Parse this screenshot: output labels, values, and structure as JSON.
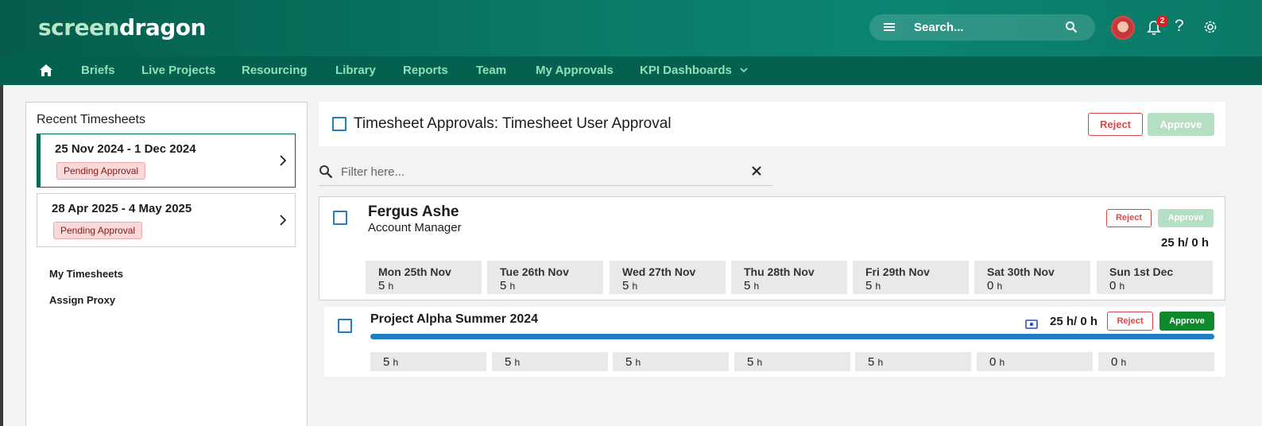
{
  "brand": {
    "logo_part1": "screen",
    "logo_part2": "dragon"
  },
  "header": {
    "search_placeholder": "Search...",
    "notification_count": "2",
    "help_symbol": "?"
  },
  "nav": {
    "items": [
      "Briefs",
      "Live Projects",
      "Resourcing",
      "Library",
      "Reports",
      "Team",
      "My Approvals",
      "KPI Dashboards"
    ]
  },
  "sidebar": {
    "title": "Recent Timesheets",
    "timesheets": [
      {
        "range": "25 Nov 2024 - 1 Dec 2024",
        "status": "Pending Approval"
      },
      {
        "range": "28 Apr 2025 - 4 May 2025",
        "status": "Pending Approval"
      }
    ],
    "links": [
      "My Timesheets",
      "Assign Proxy"
    ]
  },
  "main": {
    "title": "Timesheet Approvals: Timesheet User Approval",
    "reject_label": "Reject",
    "approve_label": "Approve",
    "filter_placeholder": "Filter here..."
  },
  "user": {
    "name": "Fergus Ashe",
    "role": "Account Manager",
    "hours_total": "25 h/ 0 h",
    "reject_label": "Reject",
    "approve_label": "Approve",
    "days": [
      {
        "label": "Mon 25th Nov",
        "value": "5",
        "unit": "h"
      },
      {
        "label": "Tue 26th Nov",
        "value": "5",
        "unit": "h"
      },
      {
        "label": "Wed 27th Nov",
        "value": "5",
        "unit": "h"
      },
      {
        "label": "Thu 28th Nov",
        "value": "5",
        "unit": "h"
      },
      {
        "label": "Fri 29th Nov",
        "value": "5",
        "unit": "h"
      },
      {
        "label": "Sat 30th Nov",
        "value": "0",
        "unit": "h"
      },
      {
        "label": "Sun 1st Dec",
        "value": "0",
        "unit": "h"
      }
    ]
  },
  "project": {
    "title": "Project Alpha Summer 2024",
    "hours_total": "25 h/ 0 h",
    "progress_percent": 100,
    "reject_label": "Reject",
    "approve_label": "Approve",
    "days": [
      {
        "value": "5",
        "unit": "h"
      },
      {
        "value": "5",
        "unit": "h"
      },
      {
        "value": "5",
        "unit": "h"
      },
      {
        "value": "5",
        "unit": "h"
      },
      {
        "value": "5",
        "unit": "h"
      },
      {
        "value": "0",
        "unit": "h"
      },
      {
        "value": "0",
        "unit": "h"
      }
    ]
  },
  "colors": {
    "brand_green": "#05614f",
    "nav_text": "#8fe0b7",
    "reject_red": "#d94848",
    "approve_green": "#0e8a2d",
    "approve_disabled": "#b5dfc3",
    "checkbox_blue": "#1e7fc4",
    "progress_blue": "#1f7fc0",
    "pending_bg": "#fbd9d9"
  },
  "icons": [
    "menu-icon",
    "search-icon",
    "avatar",
    "bell-icon",
    "help-icon",
    "gear-icon",
    "home-icon",
    "chevron-down-icon",
    "chevron-right-icon",
    "close-icon",
    "eye-icon"
  ]
}
